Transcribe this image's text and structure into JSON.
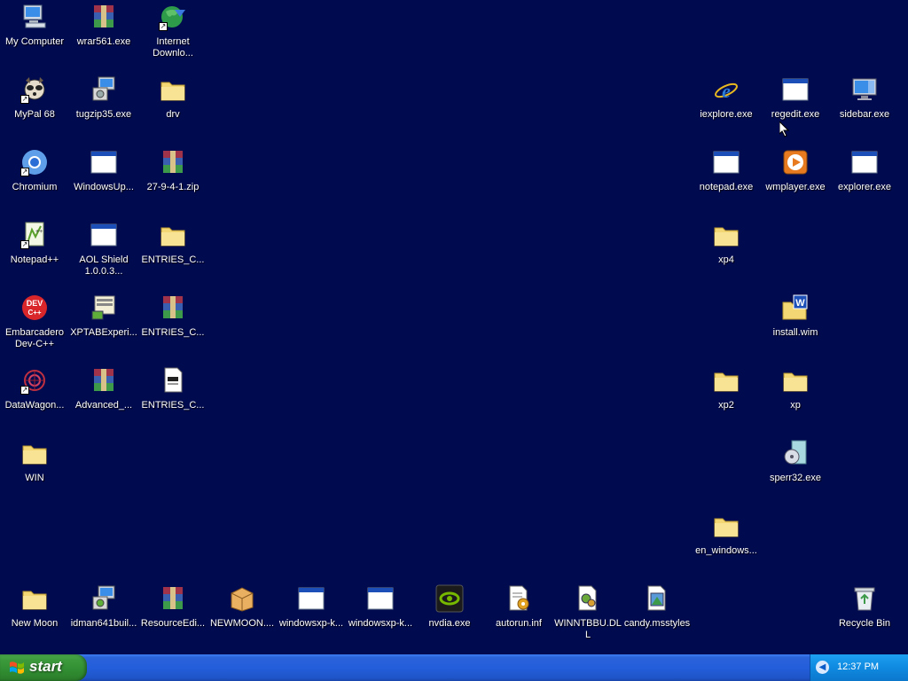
{
  "desktop": {
    "icons": {
      "my_computer": "My Computer",
      "wrar": "wrar561.exe",
      "idm_line1": "Internet",
      "idm_line2": "Downlo...",
      "mypal": "MyPal 68",
      "tugzip": "tugzip35.exe",
      "drv": "drv",
      "chromium": "Chromium",
      "windowsup": "WindowsUp...",
      "zip27": "27-9-4-1.zip",
      "notepadpp": "Notepad++",
      "aol_line1": "AOL Shield",
      "aol_line2": "1.0.0.3...",
      "entries1": "ENTRIES_C...",
      "emb_line1": "Embarcadero",
      "emb_line2": "Dev-C++",
      "xptab": "XPTABExperi...",
      "entries2": "ENTRIES_C...",
      "datawagon": "DataWagon...",
      "advanced": "Advanced_...",
      "entries3": "ENTRIES_C...",
      "win": "WIN",
      "iexplore": "iexplore.exe",
      "regedit": "regedit.exe",
      "sidebar": "sidebar.exe",
      "notepad": "notepad.exe",
      "wmplayer": "wmplayer.exe",
      "explorer": "explorer.exe",
      "xp4": "xp4",
      "install_wim": "install.wim",
      "xp2": "xp2",
      "xp": "xp",
      "sperr": "sperr32.exe",
      "en_windows": "en_windows...",
      "new_moon": "New Moon",
      "idman": "idman641buil...",
      "resourceedi": "ResourceEdi...",
      "newmoon_pkg": "NEWMOON....",
      "windowsxp_k1": "windowsxp-k...",
      "windowsxp_k2": "windowsxp-k...",
      "nvdia": "nvdia.exe",
      "autorun": "autorun.inf",
      "winntbbu": "WINNTBBU.DLL",
      "candy": "candy.msstyles",
      "recycle": "Recycle Bin"
    }
  },
  "taskbar": {
    "start_label": "start",
    "clock": "12:37 PM"
  },
  "colors": {
    "desktop": "#000b4f",
    "taskbar": "#245edb",
    "start": "#3c9a3c",
    "tray": "#0f8ae0"
  }
}
